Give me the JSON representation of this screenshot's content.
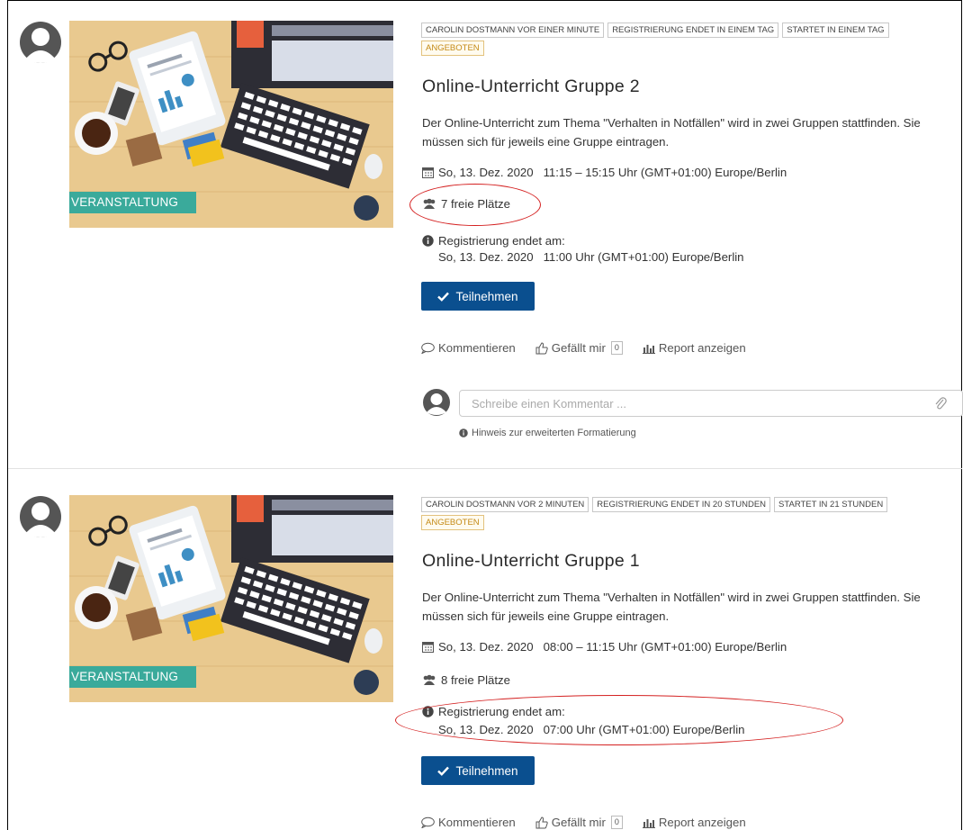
{
  "posts": [
    {
      "badges": [
        "CAROLIN DOSTMANN VOR EINER MINUTE",
        "REGISTRIERUNG ENDET IN EINEM TAG",
        "STARTET IN EINEM TAG"
      ],
      "status": "ANGEBOTEN",
      "image_label": "VERANSTALTUNG",
      "title": "Online-Unterricht Gruppe 2",
      "description": "Der Online-Unterricht zum Thema \"Verhalten in Notfällen\" wird in zwei Gruppen stattfinden. Sie müssen sich für jeweils eine Gruppe eintragen.",
      "datetime": "So, 13. Dez. 2020   11:15 – 15:15 Uhr (GMT+01:00) Europe/Berlin",
      "seats": "7 freie Plätze",
      "registration_label": "Registrierung endet am:",
      "registration_date": "So, 13. Dez. 2020   11:00 Uhr (GMT+01:00) Europe/Berlin",
      "join_label": "Teilnehmen",
      "comment_label": "Kommentieren",
      "like_label": "Gefällt mir",
      "like_count": "0",
      "report_label": "Report anzeigen",
      "comment_placeholder": "Schreibe einen Kommentar ...",
      "format_hint": "Hinweis zur erweiterten Formatierung"
    },
    {
      "badges": [
        "CAROLIN DOSTMANN VOR 2 MINUTEN",
        "REGISTRIERUNG ENDET IN 20 STUNDEN",
        "STARTET IN 21 STUNDEN"
      ],
      "status": "ANGEBOTEN",
      "image_label": "VERANSTALTUNG",
      "title": "Online-Unterricht Gruppe 1",
      "description": "Der Online-Unterricht zum Thema \"Verhalten in Notfällen\" wird in zwei Gruppen stattfinden. Sie müssen sich für jeweils eine Gruppe eintragen.",
      "datetime": "So, 13. Dez. 2020   08:00 – 11:15 Uhr (GMT+01:00) Europe/Berlin",
      "seats": "8 freie Plätze",
      "registration_label": "Registrierung endet am:",
      "registration_date": "So, 13. Dez. 2020   07:00 Uhr (GMT+01:00) Europe/Berlin",
      "join_label": "Teilnehmen",
      "comment_label": "Kommentieren",
      "like_label": "Gefällt mir",
      "like_count": "0",
      "report_label": "Report anzeigen"
    }
  ],
  "colors": {
    "primary_button": "#0a4f8f",
    "event_label": "#3aaa9b",
    "annotation": "#d42020",
    "offered_badge": "#c48a16"
  },
  "icons": [
    "user-avatar-icon",
    "calendar-icon",
    "users-icon",
    "info-icon",
    "check-icon",
    "comment-icon",
    "thumbs-up-icon",
    "bar-chart-icon",
    "paperclip-icon"
  ]
}
